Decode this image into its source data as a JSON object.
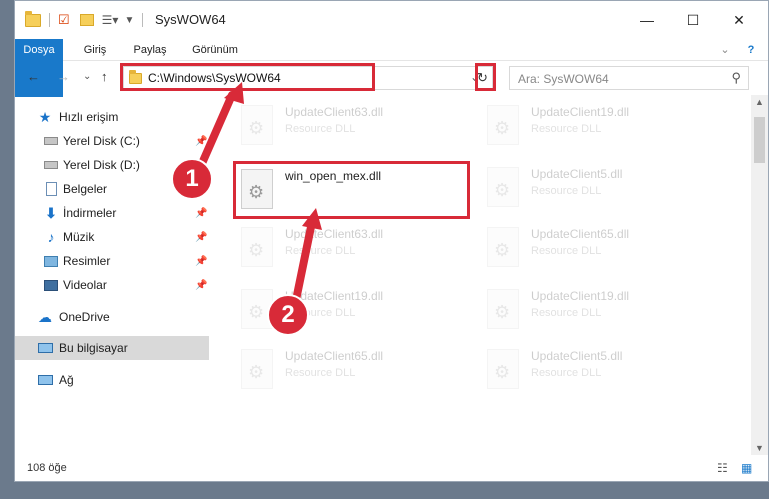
{
  "window": {
    "title": "SysWOW64",
    "controls": {
      "minimize": "—",
      "maximize": "☐",
      "close": "✕"
    }
  },
  "ribbon": {
    "tabs": [
      "Dosya",
      "Giriş",
      "Paylaş",
      "Görünüm"
    ],
    "expand": "⌄",
    "help": "?"
  },
  "nav": {
    "back": "←",
    "forward": "→",
    "dropdown": "⌄",
    "up": "↑",
    "address": "C:\\Windows\\SysWOW64",
    "refresh": "↻",
    "search_placeholder": "Ara: SysWOW64"
  },
  "sidebar": {
    "items": [
      {
        "label": "Hızlı erişim",
        "icon": "star-icon"
      },
      {
        "label": "Yerel Disk (C:)",
        "icon": "drive-icon",
        "pinned": true
      },
      {
        "label": "Yerel Disk (D:)",
        "icon": "drive-icon"
      },
      {
        "label": "Belgeler",
        "icon": "documents-icon"
      },
      {
        "label": "İndirmeler",
        "icon": "download-icon",
        "pinned": true
      },
      {
        "label": "Müzik",
        "icon": "music-icon",
        "pinned": true
      },
      {
        "label": "Resimler",
        "icon": "pictures-icon",
        "pinned": true
      },
      {
        "label": "Videolar",
        "icon": "videos-icon",
        "pinned": true
      },
      {
        "label": "OneDrive",
        "icon": "cloud-icon"
      },
      {
        "label": "Bu bilgisayar",
        "icon": "computer-icon",
        "selected": true
      },
      {
        "label": "Ağ",
        "icon": "network-icon"
      }
    ]
  },
  "files": {
    "left": [
      {
        "name": "UpdateClient63.dll",
        "type": "Resource DLL"
      },
      {
        "name": "win_open_mex.dll",
        "type": ""
      },
      {
        "name": "UpdateClient63.dll",
        "type": "Resource DLL"
      },
      {
        "name": "UpdateClient19.dll",
        "type": "Resource DLL"
      },
      {
        "name": "UpdateClient65.dll",
        "type": "Resource DLL"
      }
    ],
    "right": [
      {
        "name": "UpdateClient19.dll",
        "type": "Resource DLL"
      },
      {
        "name": "UpdateClient5.dll",
        "type": "Resource DLL"
      },
      {
        "name": "UpdateClient65.dll",
        "type": "Resource DLL"
      },
      {
        "name": "UpdateClient19.dll",
        "type": "Resource DLL"
      },
      {
        "name": "UpdateClient5.dll",
        "type": "Resource DLL"
      }
    ]
  },
  "status": {
    "count": "108 öğe"
  },
  "annotations": {
    "step1": "1",
    "step2": "2",
    "color": "#d82a38"
  }
}
